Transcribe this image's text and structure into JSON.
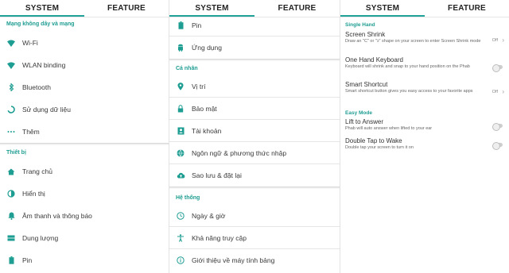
{
  "colors": {
    "accent": "#1e9d92",
    "icon": "#1e9d92"
  },
  "panel1": {
    "tabs": [
      "SYSTEM",
      "FEATURE"
    ],
    "wireless": {
      "header": "Mạng không dây và mạng",
      "items": [
        {
          "label": "Wi-Fi",
          "icon": "wifi-icon"
        },
        {
          "label": "WLAN binding",
          "icon": "wifi-icon"
        },
        {
          "label": "Bluetooth",
          "icon": "bluetooth-icon"
        },
        {
          "label": "Sử dụng dữ liệu",
          "icon": "data-usage-icon"
        },
        {
          "label": "Thêm",
          "icon": "more-icon"
        }
      ]
    },
    "device": {
      "header": "Thiết bị",
      "items": [
        {
          "label": "Trang chủ",
          "icon": "home-icon"
        },
        {
          "label": "Hiển thị",
          "icon": "brightness-icon"
        },
        {
          "label": "Âm thanh và thông báo",
          "icon": "bell-icon"
        },
        {
          "label": "Dung lượng",
          "icon": "storage-icon"
        },
        {
          "label": "Pin",
          "icon": "battery-icon"
        }
      ]
    }
  },
  "panel2": {
    "tabs": [
      "SYSTEM",
      "FEATURE"
    ],
    "top_items": [
      {
        "label": "Pin",
        "icon": "battery-icon"
      },
      {
        "label": "Ứng dụng",
        "icon": "android-icon"
      }
    ],
    "personal": {
      "header": "Cá nhân",
      "items": [
        {
          "label": "Vị trí",
          "icon": "location-icon"
        },
        {
          "label": "Bảo mật",
          "icon": "lock-icon"
        },
        {
          "label": "Tài khoản",
          "icon": "account-icon"
        },
        {
          "label": "Ngôn ngữ & phương thức nhập",
          "icon": "globe-icon"
        },
        {
          "label": "Sao lưu & đặt lại",
          "icon": "cloud-upload-icon"
        }
      ]
    },
    "system": {
      "header": "Hệ thống",
      "items": [
        {
          "label": "Ngày & giờ",
          "icon": "clock-icon"
        },
        {
          "label": "Khả năng truy cập",
          "icon": "accessibility-icon"
        },
        {
          "label": "Giới thiệu về máy tính bảng",
          "icon": "info-icon"
        }
      ]
    }
  },
  "panel3": {
    "tabs": [
      "SYSTEM",
      "FEATURE"
    ],
    "single_hand": {
      "header": "Single Hand",
      "items": [
        {
          "title": "Screen Shrink",
          "desc": "Draw an \"C\" or \"ↄ\" shape on your screen to enter Screen Shrink mode",
          "value": "Off",
          "control": "chevron"
        },
        {
          "title": "One Hand Keyboard",
          "desc": "Keyboard will shrink and snap to your hand position on the Phab",
          "control": "toggle"
        },
        {
          "title": "Smart Shortcut",
          "desc": "Smart shortcut button gives you easy access to your favorite apps",
          "value": "Off",
          "control": "chevron"
        }
      ]
    },
    "easy_mode": {
      "header": "Easy Mode",
      "items": [
        {
          "title": "Lift to Answer",
          "desc": "Phab will auto answer when lifted to your ear",
          "control": "toggle"
        },
        {
          "title": "Double Tap to Wake",
          "desc": "Double tap your screen to turn it on",
          "control": "toggle"
        }
      ]
    }
  }
}
